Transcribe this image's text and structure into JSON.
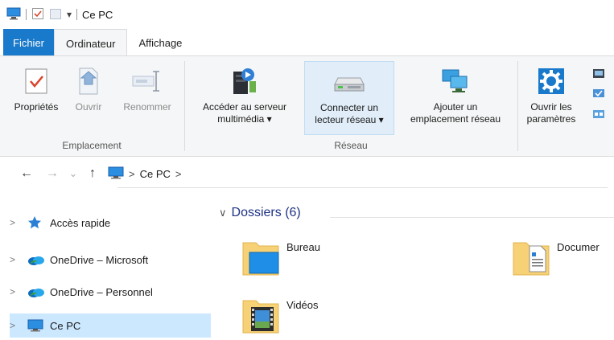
{
  "titlebar": {
    "title": "Ce PC"
  },
  "tabs": {
    "file": "Fichier",
    "computer": "Ordinateur",
    "view": "Affichage"
  },
  "ribbon": {
    "location_group": {
      "label": "Emplacement",
      "properties": "Propriétés",
      "open": "Ouvrir",
      "rename": "Renommer"
    },
    "network_group": {
      "label": "Réseau",
      "media_line1": "Accéder au serveur",
      "media_line2": "multimédia ▾",
      "map_line1": "Connecter un",
      "map_line2": "lecteur réseau ▾",
      "add_line1": "Ajouter un",
      "add_line2": "emplacement réseau"
    },
    "system_group": {
      "settings_line1": "Ouvrir les",
      "settings_line2": "paramètres"
    }
  },
  "address": {
    "back": "←",
    "forward": "→",
    "recent": "⌄",
    "up": "↑",
    "crumb_sep": ">",
    "location": "Ce PC",
    "trailing_sep": ">"
  },
  "sidebar": {
    "items": [
      {
        "label": "Accès rapide",
        "icon": "star-icon"
      },
      {
        "label": "OneDrive – Microsoft",
        "icon": "onedrive-icon"
      },
      {
        "label": "OneDrive – Personnel",
        "icon": "onedrive-icon"
      },
      {
        "label": "Ce PC",
        "icon": "monitor-icon"
      }
    ]
  },
  "content": {
    "section": "Dossiers (6)",
    "folders": [
      {
        "name": "Bureau",
        "icon": "desktop-folder-icon"
      },
      {
        "name": "Documer",
        "icon": "documents-folder-icon"
      },
      {
        "name": "Vidéos",
        "icon": "videos-folder-icon"
      }
    ]
  },
  "colors": {
    "file_tab": "#1979ca",
    "selection": "#cce8ff",
    "section_title": "#1e3287"
  }
}
